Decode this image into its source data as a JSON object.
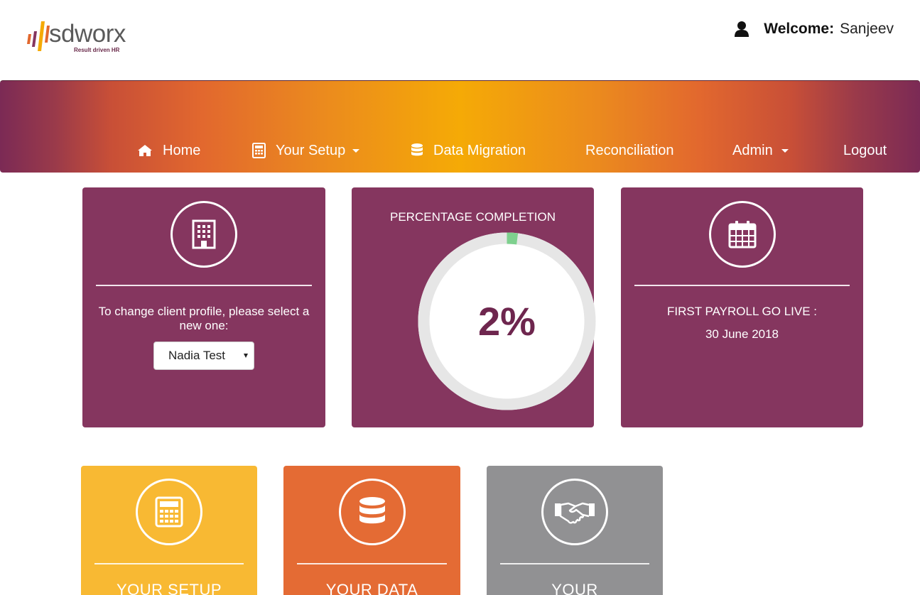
{
  "header": {
    "logo": {
      "name": "sdworx",
      "tagline": "Result driven HR"
    },
    "welcome_label": "Welcome:",
    "user_name": "Sanjeev",
    "user_icon": "user-icon"
  },
  "nav": {
    "items": [
      {
        "label": "Home",
        "icon": "home-icon"
      },
      {
        "label": "Your Setup",
        "icon": "calculator-icon",
        "dropdown": true
      },
      {
        "label": "Data Migration",
        "icon": "database-icon"
      },
      {
        "label": "Reconciliation"
      },
      {
        "label": "Admin",
        "dropdown": true
      },
      {
        "label": "Logout"
      }
    ]
  },
  "cards": {
    "profile": {
      "icon": "building-icon",
      "text": "To change client profile, please select a new one:",
      "selected_client": "Nadia Test"
    },
    "completion": {
      "title": "PERCENTAGE COMPLETION",
      "value_label": "2%",
      "percent": 2,
      "progress_color": "#7ed08e",
      "track_color": "#e6e6e6"
    },
    "golive": {
      "icon": "calendar-icon",
      "title": "FIRST PAYROLL GO LIVE :",
      "date": "30 June 2018"
    }
  },
  "tiles": [
    {
      "label": "YOUR SETUP",
      "icon": "calculator-icon",
      "color": "#f8b933"
    },
    {
      "label": "YOUR DATA",
      "icon": "database-icon",
      "color": "#e46b34"
    },
    {
      "label": "YOUR",
      "icon": "handshake-icon",
      "color": "#919193"
    }
  ],
  "colors": {
    "card_bg": "#85365f",
    "percent_text": "#6e264e"
  }
}
